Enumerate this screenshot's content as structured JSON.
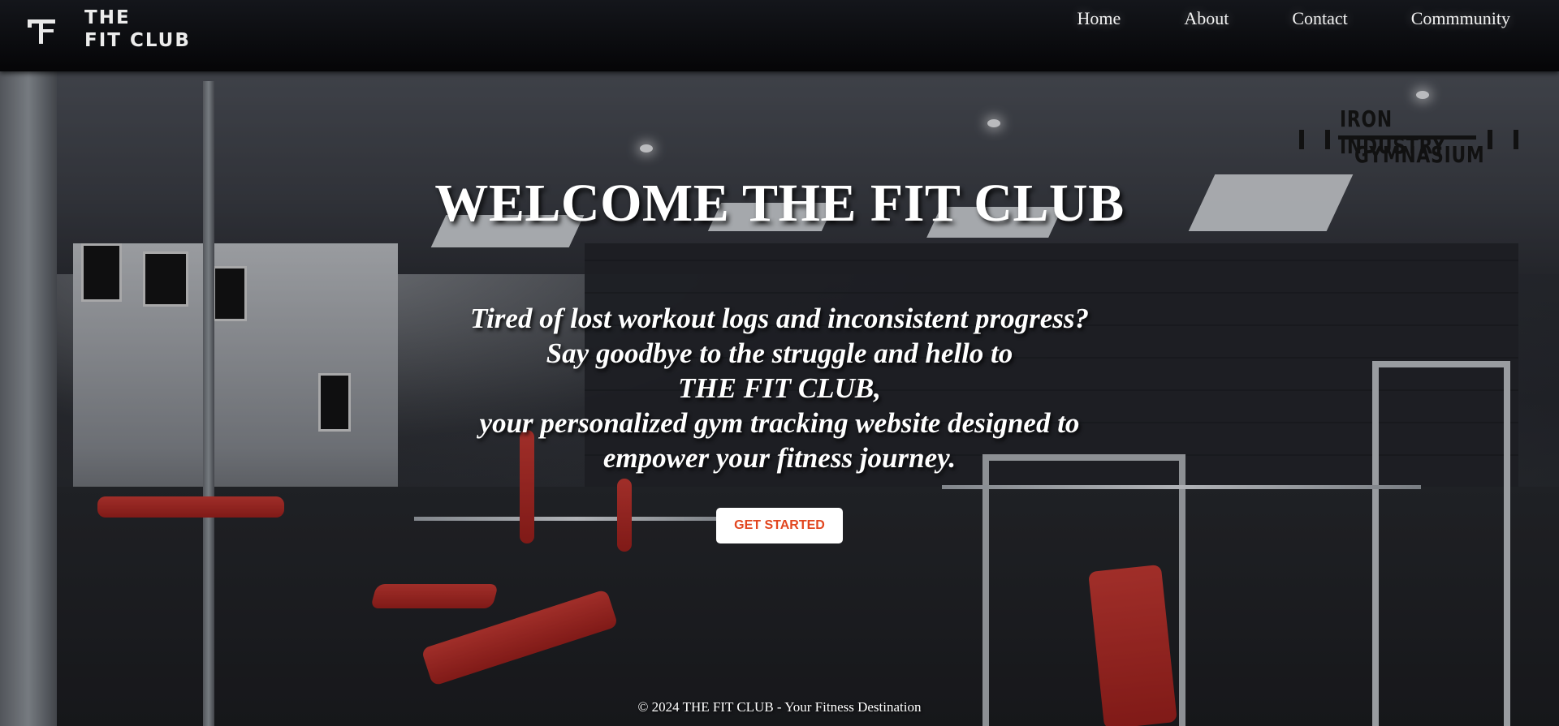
{
  "header": {
    "brand_line1": "THE",
    "brand_line2": "FIT CLUB",
    "nav": [
      "Home",
      "About",
      "Contact",
      "Commmunity"
    ]
  },
  "hero": {
    "title": "WELCOME THE FIT CLUB",
    "tagline": [
      "Tired of lost workout logs and inconsistent progress?",
      "Say goodbye to the struggle and hello to",
      "THE FIT CLUB,",
      "your personalized gym tracking website designed to",
      "empower your fitness journey."
    ],
    "cta_label": "GET STARTED"
  },
  "wall_logo": {
    "line1": "IRON INDUSTRY",
    "line2": "GYMNASIUM"
  },
  "footer": {
    "text": "© 2024 THE FIT CLUB - Your Fitness Destination"
  },
  "colors": {
    "cta_text": "#e2461f",
    "cta_bg": "#ffffff",
    "header_bg": "#050507"
  }
}
